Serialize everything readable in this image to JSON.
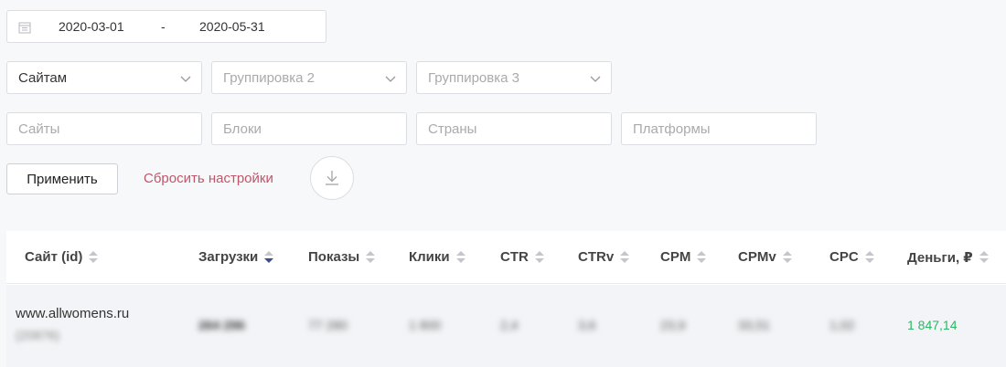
{
  "date_range": {
    "from": "2020-03-01",
    "separator": "-",
    "to": "2020-05-31"
  },
  "groupings": [
    {
      "value": "Сайтам",
      "is_placeholder": false
    },
    {
      "value": "Группировка 2",
      "is_placeholder": true
    },
    {
      "value": "Группировка 3",
      "is_placeholder": true
    }
  ],
  "filters": {
    "sites_placeholder": "Сайты",
    "blocks_placeholder": "Блоки",
    "countries_placeholder": "Страны",
    "platforms_placeholder": "Платформы"
  },
  "actions": {
    "apply_label": "Применить",
    "reset_label": "Сбросить настройки"
  },
  "table": {
    "columns": [
      "Сайт (id)",
      "Загрузки",
      "Показы",
      "Клики",
      "CTR",
      "CTRv",
      "CPM",
      "CPMv",
      "CPC",
      "Деньги, ₽"
    ],
    "active_sort_column": "Загрузки",
    "rows": [
      {
        "site": "www.allwomens.ru",
        "site_id": "(20876)",
        "loads": "264 296",
        "impressions": "77 280",
        "clicks": "1 800",
        "ctr": "2,4",
        "ctrv": "3,6",
        "cpm": "23,9",
        "cpmv": "33,51",
        "cpc": "1,02",
        "money": "1 847,14"
      }
    ]
  },
  "colors": {
    "accent": "#3f4a8a",
    "reset": "#c0566a",
    "money": "#2fb566"
  }
}
